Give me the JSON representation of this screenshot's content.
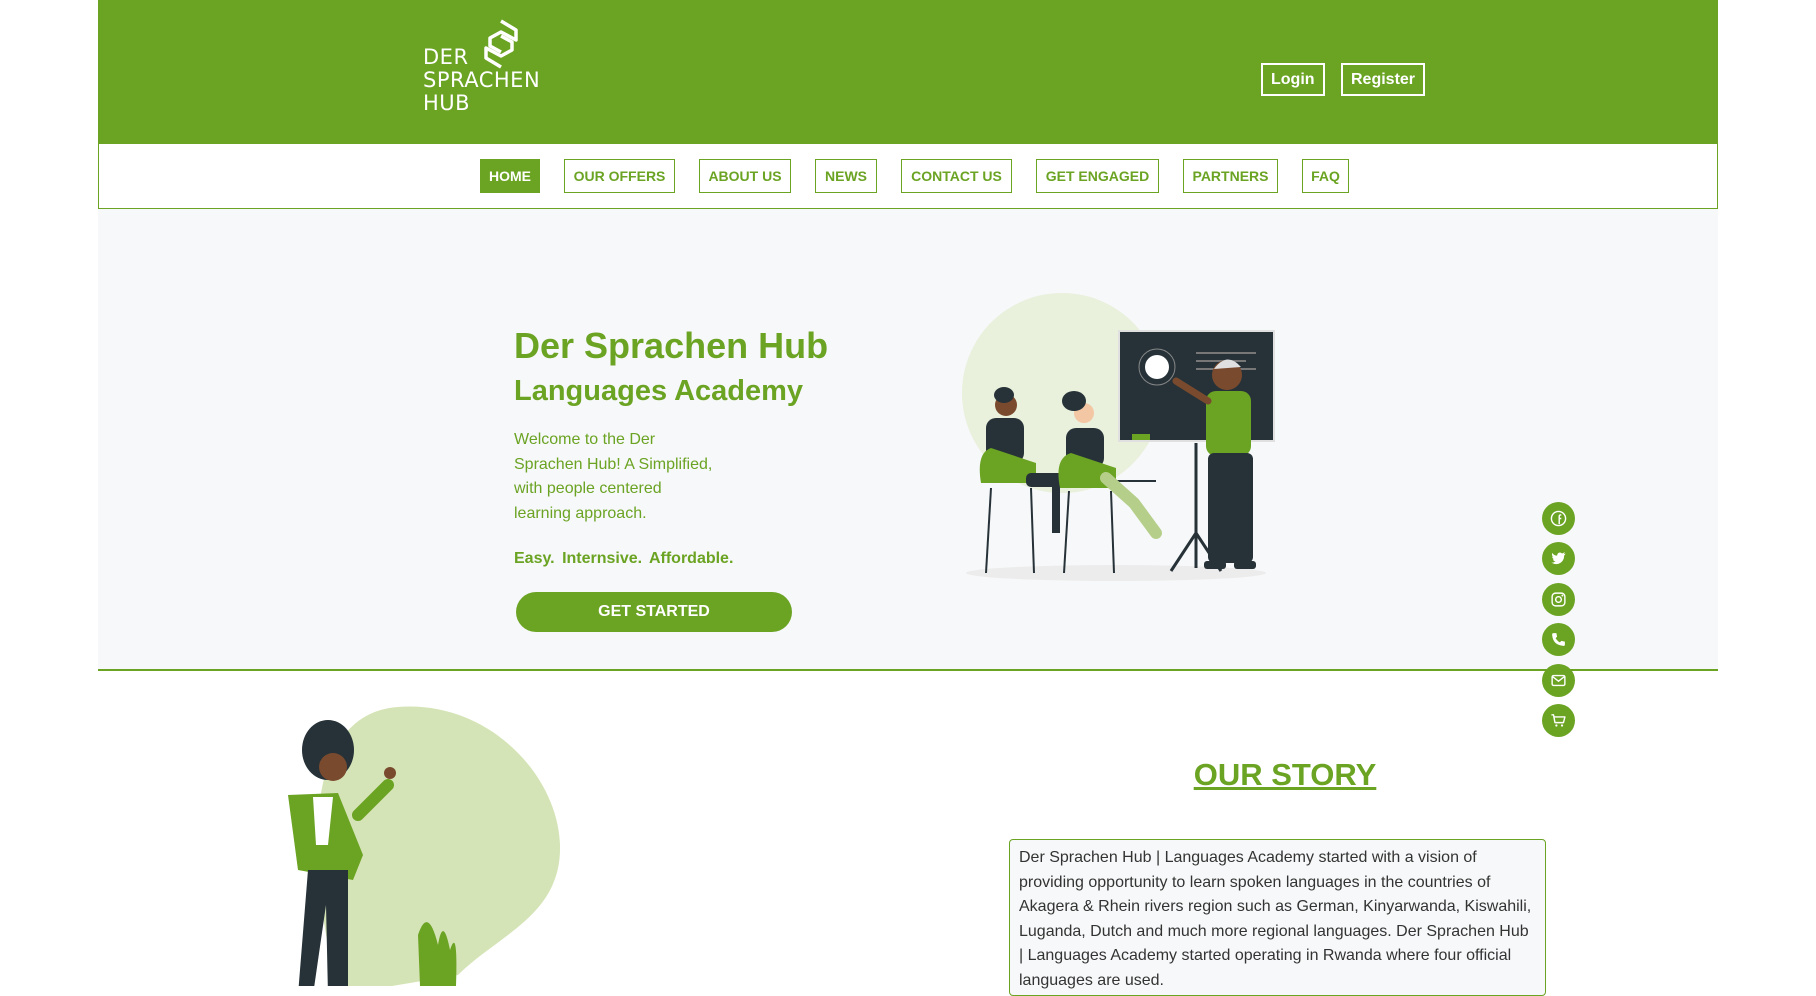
{
  "brand": {
    "logo_text": "DER SPRACHEN HUB",
    "colors": {
      "primary": "#6ba323",
      "light": "#d5e4b6",
      "dark": "#263238",
      "panel": "#f7f8f9"
    }
  },
  "header": {
    "login_label": "Login",
    "register_label": "Register"
  },
  "nav": {
    "items": [
      {
        "label": "HOME",
        "active": true
      },
      {
        "label": "OUR OFFERS",
        "active": false
      },
      {
        "label": "ABOUT US",
        "active": false
      },
      {
        "label": "NEWS",
        "active": false
      },
      {
        "label": "CONTACT US",
        "active": false
      },
      {
        "label": "GET ENGAGED",
        "active": false
      },
      {
        "label": "PARTNERS",
        "active": false
      },
      {
        "label": "FAQ",
        "active": false
      }
    ]
  },
  "hero": {
    "title": "Der Sprachen Hub",
    "subtitle": "Languages Academy",
    "intro": "Welcome to the Der Sprachen Hub! A Simplified, with people centered learning approach.",
    "tagline": "Easy.  Internsive.  Affordable.",
    "cta_label": "GET STARTED"
  },
  "social": {
    "icons": [
      "facebook-icon",
      "twitter-icon",
      "instagram-icon",
      "phone-icon",
      "mail-icon",
      "cart-icon"
    ]
  },
  "story": {
    "title": "OUR STORY",
    "text": "Der Sprachen Hub | Languages Academy started with a vision of providing opportunity to learn spoken languages in the countries of Akagera & Rhein rivers region such as German, Kinyarwanda, Kiswahili, Luganda, Dutch and much more regional languages. Der Sprachen Hub | Languages Academy started operating in Rwanda where four official languages are used."
  }
}
